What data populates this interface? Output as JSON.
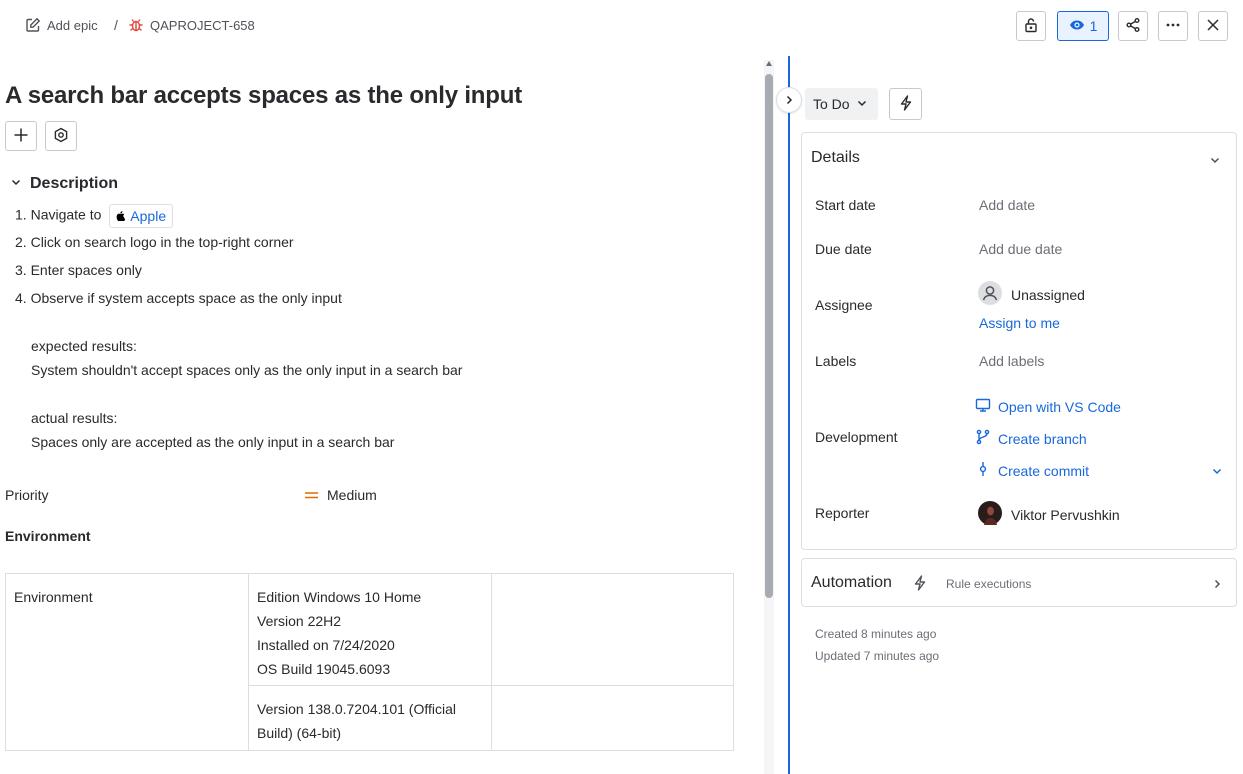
{
  "breadcrumb": {
    "add_epic": "Add epic",
    "separator": "/",
    "issue_key": "QAPROJECT-658"
  },
  "toolbar": {
    "watch_count": "1"
  },
  "issue": {
    "title": "A search bar accepts spaces as the only input"
  },
  "description": {
    "heading": "Description",
    "steps": [
      {
        "num": "1.",
        "text": "Navigate to",
        "link": "Apple"
      },
      {
        "num": "2.",
        "text": "Click on search logo in the top-right corner"
      },
      {
        "num": "3.",
        "text": "Enter spaces only"
      },
      {
        "num": "4.",
        "text": "Observe if system accepts space as the only input"
      }
    ],
    "expected_label": "expected results:",
    "expected_text": "System shouldn't accept spaces only as the only input in a search bar",
    "actual_label": "actual results:",
    "actual_text": "Spaces only are accepted as the only input in a search bar"
  },
  "priority": {
    "label": "Priority",
    "value": "Medium",
    "color": "#e06c00"
  },
  "environment": {
    "label": "Environment",
    "table": {
      "row1": {
        "col1": "Environment",
        "col2_lines": [
          "Edition Windows 10 Home",
          "Version 22H2",
          "Installed on 7/24/2020",
          "OS Build 19045.6093"
        ],
        "col3": ""
      },
      "row2": {
        "col2_lines": [
          "Version 138.0.7204.101 (Official",
          "Build) (64-bit)"
        ],
        "col3": ""
      }
    }
  },
  "status": {
    "value": "To Do"
  },
  "details": {
    "heading": "Details",
    "start_date": {
      "label": "Start date",
      "value": "Add date"
    },
    "due_date": {
      "label": "Due date",
      "value": "Add due date"
    },
    "assignee": {
      "label": "Assignee",
      "value": "Unassigned",
      "action": "Assign to me"
    },
    "labels": {
      "label": "Labels",
      "value": "Add labels"
    },
    "development": {
      "label": "Development",
      "items": [
        "Open with VS Code",
        "Create branch",
        "Create commit"
      ]
    },
    "reporter": {
      "label": "Reporter",
      "value": "Viktor Pervushkin"
    }
  },
  "automation": {
    "heading": "Automation",
    "sub": "Rule executions"
  },
  "meta": {
    "created": "Created 8 minutes ago",
    "updated": "Updated 7 minutes ago"
  },
  "colors": {
    "accent": "#1868db",
    "bug": "#e2483d"
  }
}
